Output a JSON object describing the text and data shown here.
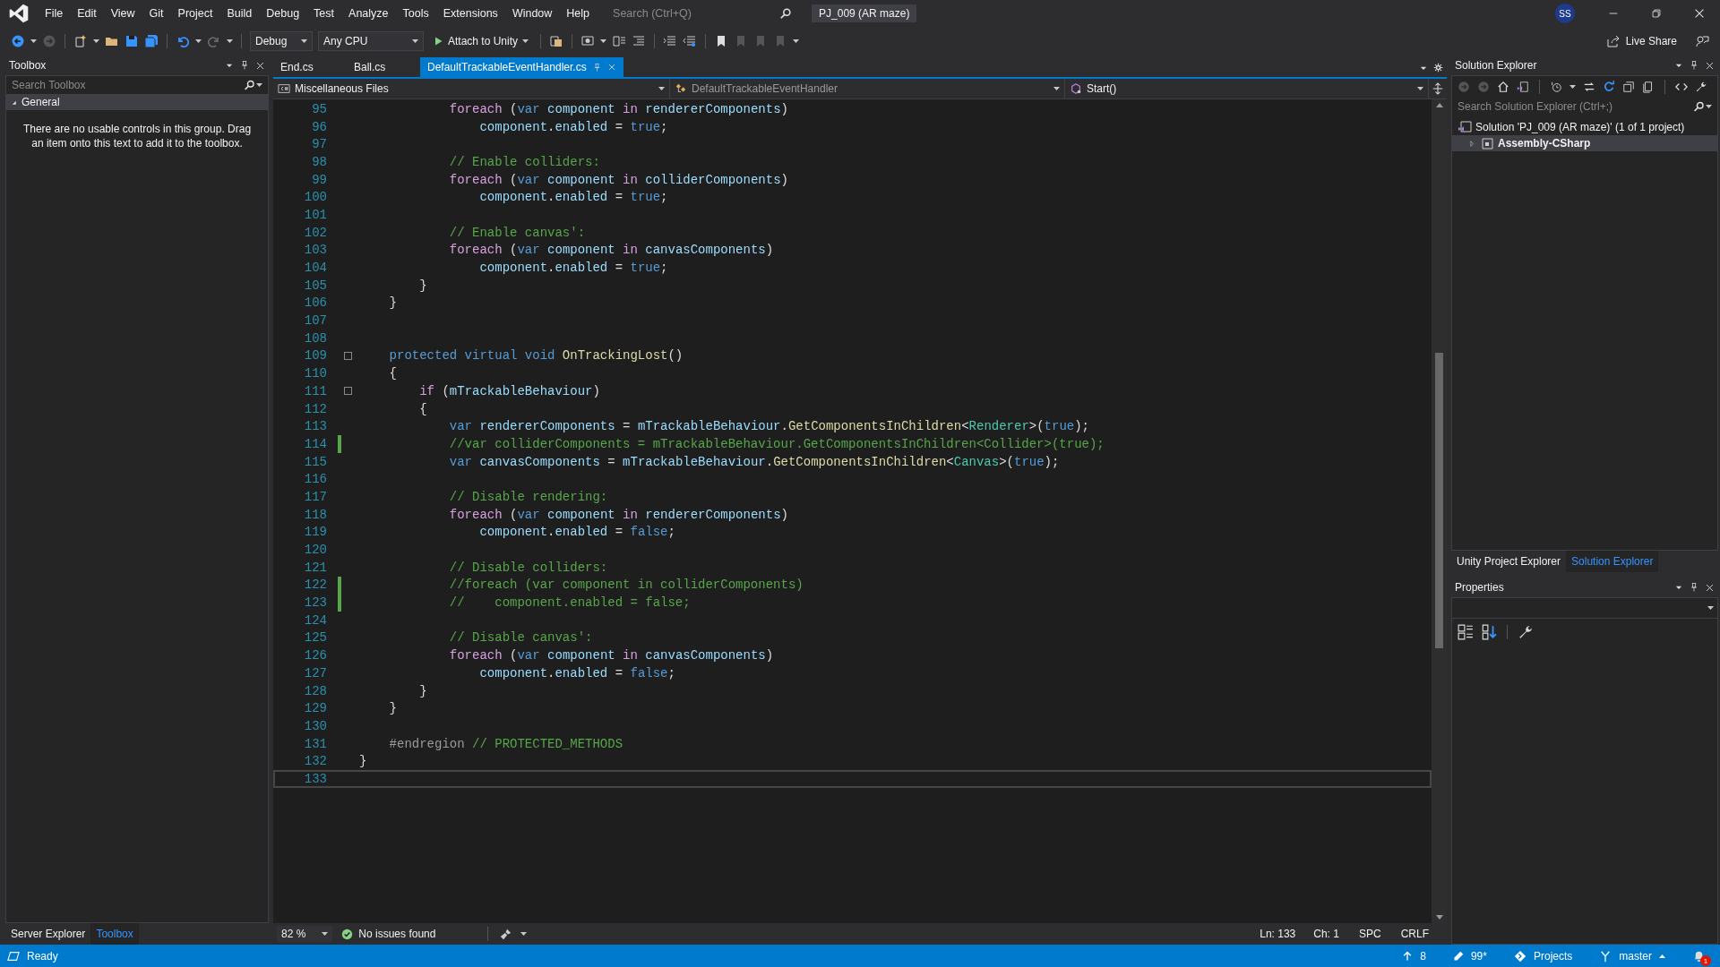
{
  "title_bar": {
    "menu": [
      "File",
      "Edit",
      "View",
      "Git",
      "Project",
      "Build",
      "Debug",
      "Test",
      "Analyze",
      "Tools",
      "Extensions",
      "Window",
      "Help"
    ],
    "search": {
      "placeholder": "Search (Ctrl+Q)"
    },
    "solution_name": "PJ_009 (AR maze)",
    "account_initials": "SS"
  },
  "toolbar": {
    "configuration": "Debug",
    "platform": "Any CPU",
    "run_button": "Attach to Unity",
    "live_share": "Live Share"
  },
  "toolbox": {
    "title": "Toolbox",
    "search": {
      "placeholder": "Search Toolbox"
    },
    "groups": [
      {
        "label": "General",
        "expanded": true,
        "message": "There are no usable controls in this group. Drag an item onto this text to add it to the toolbox."
      }
    ],
    "tabs": [
      {
        "label": "Server Explorer",
        "selected": false
      },
      {
        "label": "Toolbox",
        "selected": true
      }
    ]
  },
  "editor": {
    "tabs": [
      {
        "label": "End.cs",
        "selected": false,
        "pinned": false
      },
      {
        "label": "Ball.cs",
        "selected": false,
        "pinned": false
      },
      {
        "label": "DefaultTrackableEventHandler.cs",
        "selected": true,
        "pinned": true
      }
    ],
    "nav": {
      "project": "Miscellaneous Files",
      "type": "DefaultTrackableEventHandler",
      "member": "Start()"
    },
    "lines": [
      {
        "number": "95",
        "changed": false,
        "foldable": false,
        "current": false,
        "tokens": [
          {
            "kind": "ctl",
            "text": "            foreach"
          },
          {
            "kind": "txt",
            "text": " ("
          },
          {
            "kind": "kw",
            "text": "var"
          },
          {
            "kind": "var",
            "text": " component "
          },
          {
            "kind": "ctl",
            "text": "in"
          },
          {
            "kind": "var",
            "text": " rendererComponents"
          },
          {
            "kind": "txt",
            "text": ")"
          }
        ]
      },
      {
        "number": "96",
        "changed": false,
        "foldable": false,
        "current": false,
        "tokens": [
          {
            "kind": "var",
            "text": "                component"
          },
          {
            "kind": "txt",
            "text": "."
          },
          {
            "kind": "var",
            "text": "enabled"
          },
          {
            "kind": "txt",
            "text": " = "
          },
          {
            "kind": "kw",
            "text": "true"
          },
          {
            "kind": "txt",
            "text": ";"
          }
        ]
      },
      {
        "number": "97",
        "changed": false,
        "foldable": false,
        "current": false
      },
      {
        "number": "98",
        "changed": false,
        "foldable": false,
        "current": false,
        "tokens": [
          {
            "kind": "cmt",
            "text": "            // Enable colliders:"
          }
        ]
      },
      {
        "number": "99",
        "changed": false,
        "foldable": false,
        "current": false,
        "tokens": [
          {
            "kind": "ctl",
            "text": "            foreach"
          },
          {
            "kind": "txt",
            "text": " ("
          },
          {
            "kind": "kw",
            "text": "var"
          },
          {
            "kind": "var",
            "text": " component "
          },
          {
            "kind": "ctl",
            "text": "in"
          },
          {
            "kind": "var",
            "text": " colliderComponents"
          },
          {
            "kind": "txt",
            "text": ")"
          }
        ]
      },
      {
        "number": "100",
        "changed": false,
        "foldable": false,
        "current": false,
        "tokens": [
          {
            "kind": "var",
            "text": "                component"
          },
          {
            "kind": "txt",
            "text": "."
          },
          {
            "kind": "var",
            "text": "enabled"
          },
          {
            "kind": "txt",
            "text": " = "
          },
          {
            "kind": "kw",
            "text": "true"
          },
          {
            "kind": "txt",
            "text": ";"
          }
        ]
      },
      {
        "number": "101",
        "changed": false,
        "foldable": false,
        "current": false
      },
      {
        "number": "102",
        "changed": false,
        "foldable": false,
        "current": false,
        "tokens": [
          {
            "kind": "cmt",
            "text": "            // Enable canvas':"
          }
        ]
      },
      {
        "number": "103",
        "changed": false,
        "foldable": false,
        "current": false,
        "tokens": [
          {
            "kind": "ctl",
            "text": "            foreach"
          },
          {
            "kind": "txt",
            "text": " ("
          },
          {
            "kind": "kw",
            "text": "var"
          },
          {
            "kind": "var",
            "text": " component "
          },
          {
            "kind": "ctl",
            "text": "in"
          },
          {
            "kind": "var",
            "text": " canvasComponents"
          },
          {
            "kind": "txt",
            "text": ")"
          }
        ]
      },
      {
        "number": "104",
        "changed": false,
        "foldable": false,
        "current": false,
        "tokens": [
          {
            "kind": "var",
            "text": "                component"
          },
          {
            "kind": "txt",
            "text": "."
          },
          {
            "kind": "var",
            "text": "enabled"
          },
          {
            "kind": "txt",
            "text": " = "
          },
          {
            "kind": "kw",
            "text": "true"
          },
          {
            "kind": "txt",
            "text": ";"
          }
        ]
      },
      {
        "number": "105",
        "changed": false,
        "foldable": false,
        "current": false,
        "tokens": [
          {
            "kind": "txt",
            "text": "        }"
          }
        ]
      },
      {
        "number": "106",
        "changed": false,
        "foldable": false,
        "current": false,
        "tokens": [
          {
            "kind": "txt",
            "text": "    }"
          }
        ]
      },
      {
        "number": "107",
        "changed": false,
        "foldable": false,
        "current": false
      },
      {
        "number": "108",
        "changed": false,
        "foldable": false,
        "current": false
      },
      {
        "number": "109",
        "changed": false,
        "foldable": true,
        "current": false,
        "tokens": [
          {
            "kind": "kw",
            "text": "    protected virtual void"
          },
          {
            "kind": "fn",
            "text": " OnTrackingLost"
          },
          {
            "kind": "txt",
            "text": "()"
          }
        ]
      },
      {
        "number": "110",
        "changed": false,
        "foldable": false,
        "current": false,
        "tokens": [
          {
            "kind": "txt",
            "text": "    {"
          }
        ]
      },
      {
        "number": "111",
        "changed": false,
        "foldable": true,
        "current": false,
        "tokens": [
          {
            "kind": "ctl",
            "text": "        if"
          },
          {
            "kind": "txt",
            "text": " ("
          },
          {
            "kind": "var",
            "text": "mTrackableBehaviour"
          },
          {
            "kind": "txt",
            "text": ")"
          }
        ]
      },
      {
        "number": "112",
        "changed": false,
        "foldable": false,
        "current": false,
        "tokens": [
          {
            "kind": "txt",
            "text": "        {"
          }
        ]
      },
      {
        "number": "113",
        "changed": false,
        "foldable": false,
        "current": false,
        "tokens": [
          {
            "kind": "kw",
            "text": "            var"
          },
          {
            "kind": "var",
            "text": " rendererComponents"
          },
          {
            "kind": "txt",
            "text": " = "
          },
          {
            "kind": "var",
            "text": "mTrackableBehaviour"
          },
          {
            "kind": "txt",
            "text": "."
          },
          {
            "kind": "fn",
            "text": "GetComponentsInChildren"
          },
          {
            "kind": "txt",
            "text": "<"
          },
          {
            "kind": "type",
            "text": "Renderer"
          },
          {
            "kind": "txt",
            "text": ">("
          },
          {
            "kind": "kw",
            "text": "true"
          },
          {
            "kind": "txt",
            "text": ");"
          }
        ]
      },
      {
        "number": "114",
        "changed": true,
        "foldable": false,
        "current": false,
        "tokens": [
          {
            "kind": "cmt",
            "text": "            //var colliderComponents = mTrackableBehaviour.GetComponentsInChildren<Collider>(true);"
          }
        ]
      },
      {
        "number": "115",
        "changed": false,
        "foldable": false,
        "current": false,
        "tokens": [
          {
            "kind": "kw",
            "text": "            var"
          },
          {
            "kind": "var",
            "text": " canvasComponents"
          },
          {
            "kind": "txt",
            "text": " = "
          },
          {
            "kind": "var",
            "text": "mTrackableBehaviour"
          },
          {
            "kind": "txt",
            "text": "."
          },
          {
            "kind": "fn",
            "text": "GetComponentsInChildren"
          },
          {
            "kind": "txt",
            "text": "<"
          },
          {
            "kind": "type",
            "text": "Canvas"
          },
          {
            "kind": "txt",
            "text": ">("
          },
          {
            "kind": "kw",
            "text": "true"
          },
          {
            "kind": "txt",
            "text": ");"
          }
        ]
      },
      {
        "number": "116",
        "changed": false,
        "foldable": false,
        "current": false
      },
      {
        "number": "117",
        "changed": false,
        "foldable": false,
        "current": false,
        "tokens": [
          {
            "kind": "cmt",
            "text": "            // Disable rendering:"
          }
        ]
      },
      {
        "number": "118",
        "changed": false,
        "foldable": false,
        "current": false,
        "tokens": [
          {
            "kind": "ctl",
            "text": "            foreach"
          },
          {
            "kind": "txt",
            "text": " ("
          },
          {
            "kind": "kw",
            "text": "var"
          },
          {
            "kind": "var",
            "text": " component "
          },
          {
            "kind": "ctl",
            "text": "in"
          },
          {
            "kind": "var",
            "text": " rendererComponents"
          },
          {
            "kind": "txt",
            "text": ")"
          }
        ]
      },
      {
        "number": "119",
        "changed": false,
        "foldable": false,
        "current": false,
        "tokens": [
          {
            "kind": "var",
            "text": "                component"
          },
          {
            "kind": "txt",
            "text": "."
          },
          {
            "kind": "var",
            "text": "enabled"
          },
          {
            "kind": "txt",
            "text": " = "
          },
          {
            "kind": "kw",
            "text": "false"
          },
          {
            "kind": "txt",
            "text": ";"
          }
        ]
      },
      {
        "number": "120",
        "changed": false,
        "foldable": false,
        "current": false
      },
      {
        "number": "121",
        "changed": false,
        "foldable": false,
        "current": false,
        "tokens": [
          {
            "kind": "cmt",
            "text": "            // Disable colliders:"
          }
        ]
      },
      {
        "number": "122",
        "changed": true,
        "foldable": false,
        "current": false,
        "tokens": [
          {
            "kind": "cmt",
            "text": "            //foreach (var component in colliderComponents)"
          }
        ]
      },
      {
        "number": "123",
        "changed": true,
        "foldable": false,
        "current": false,
        "tokens": [
          {
            "kind": "cmt",
            "text": "            //    component.enabled = false;"
          }
        ]
      },
      {
        "number": "124",
        "changed": false,
        "foldable": false,
        "current": false
      },
      {
        "number": "125",
        "changed": false,
        "foldable": false,
        "current": false,
        "tokens": [
          {
            "kind": "cmt",
            "text": "            // Disable canvas':"
          }
        ]
      },
      {
        "number": "126",
        "changed": false,
        "foldable": false,
        "current": false,
        "tokens": [
          {
            "kind": "ctl",
            "text": "            foreach"
          },
          {
            "kind": "txt",
            "text": " ("
          },
          {
            "kind": "kw",
            "text": "var"
          },
          {
            "kind": "var",
            "text": " component "
          },
          {
            "kind": "ctl",
            "text": "in"
          },
          {
            "kind": "var",
            "text": " canvasComponents"
          },
          {
            "kind": "txt",
            "text": ")"
          }
        ]
      },
      {
        "number": "127",
        "changed": false,
        "foldable": false,
        "current": false,
        "tokens": [
          {
            "kind": "var",
            "text": "                component"
          },
          {
            "kind": "txt",
            "text": "."
          },
          {
            "kind": "var",
            "text": "enabled"
          },
          {
            "kind": "txt",
            "text": " = "
          },
          {
            "kind": "kw",
            "text": "false"
          },
          {
            "kind": "txt",
            "text": ";"
          }
        ]
      },
      {
        "number": "128",
        "changed": false,
        "foldable": false,
        "current": false,
        "tokens": [
          {
            "kind": "txt",
            "text": "        }"
          }
        ]
      },
      {
        "number": "129",
        "changed": false,
        "foldable": false,
        "current": false,
        "tokens": [
          {
            "kind": "txt",
            "text": "    }"
          }
        ]
      },
      {
        "number": "130",
        "changed": false,
        "foldable": false,
        "current": false
      },
      {
        "number": "131",
        "changed": false,
        "foldable": false,
        "current": false,
        "tokens": [
          {
            "kind": "pre",
            "text": "    #endregion"
          },
          {
            "kind": "cmt",
            "text": " // PROTECTED_METHODS"
          }
        ]
      },
      {
        "number": "132",
        "changed": false,
        "foldable": false,
        "current": false,
        "tokens": [
          {
            "kind": "txt",
            "text": "}"
          }
        ]
      },
      {
        "number": "133",
        "changed": false,
        "foldable": false,
        "current": true
      }
    ],
    "footer": {
      "zoom": "82 %",
      "issues": "No issues found",
      "line": "Ln: 133",
      "column": "Ch: 1",
      "whitespace": "SPC",
      "line_ending": "CRLF"
    }
  },
  "solution_explorer": {
    "title": "Solution Explorer",
    "search": {
      "placeholder": "Search Solution Explorer (Ctrl+;)"
    },
    "tree": [
      {
        "label": "Solution 'PJ_009 (AR maze)' (1 of 1 project)",
        "kind": "solution",
        "expanded": true,
        "selected": false,
        "children": [
          {
            "label": "Assembly-CSharp",
            "kind": "project",
            "expanded": false,
            "selected": true
          }
        ]
      }
    ],
    "tabs": [
      {
        "label": "Unity Project Explorer",
        "selected": false
      },
      {
        "label": "Solution Explorer",
        "selected": true
      }
    ]
  },
  "properties": {
    "title": "Properties"
  },
  "status_bar": {
    "status": "Ready",
    "unpushed": "8",
    "changes": "99*",
    "projects": "Projects",
    "branch": "master",
    "notifications": "1"
  }
}
